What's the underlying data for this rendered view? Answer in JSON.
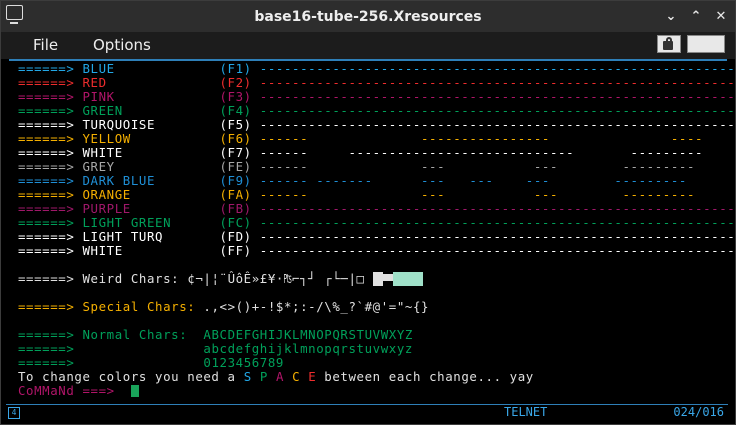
{
  "window": {
    "title": "base16-tube-256.Xresources",
    "buttons": [
      "⌄",
      "⌃",
      "✕"
    ]
  },
  "menu": {
    "file": "File",
    "options": "Options"
  },
  "colors": {
    "blue": "#22a7e6",
    "red": "#ee2d2d",
    "pink": "#b11569",
    "green": "#00a05a",
    "turquoise": "#ffffff",
    "yellow": "#f5b000",
    "white": "#ffffff",
    "grey": "#a8a8a8",
    "darkblue": "#1f8fd6",
    "orange": "#f5b000",
    "purple": "#a0186a",
    "lightgreen": "#00a05a",
    "lightturq": "#ffffff",
    "status": "#3aa7e8"
  },
  "terminal": {
    "color_rows": [
      {
        "arrow": "======>",
        "name": "BLUE",
        "key": "(F1)",
        "bar": "-----------------------------------------------------------",
        "color": "#22a7e6"
      },
      {
        "arrow": "======>",
        "name": "RED",
        "key": "(F2)",
        "bar": "-----------------------------------------------------------",
        "color": "#ee2d2d"
      },
      {
        "arrow": "======>",
        "name": "PINK",
        "key": "(F3)",
        "bar": "-----------------------------------------------------------",
        "color": "#b11569"
      },
      {
        "arrow": "======>",
        "name": "GREEN",
        "key": "(F4)",
        "bar": "-----------------------------------------------------------",
        "color": "#00a05a"
      },
      {
        "arrow": "======>",
        "name": "TURQUOISE",
        "key": "(F5)",
        "bar": "-----------------------------------------------------------",
        "color": "#ffffff"
      },
      {
        "arrow": "======>",
        "name": "YELLOW",
        "key": "(F6)",
        "bar": "------              ----------------               ----",
        "color": "#f5b000"
      },
      {
        "arrow": "======>",
        "name": "WHITE",
        "key": "(F7)",
        "bar": "------     ----------------------------       ---------",
        "color": "#ffffff"
      },
      {
        "arrow": "======>",
        "name": "GREY",
        "key": "(FE)",
        "bar": "------              ---           ---        ---------",
        "color": "#a8a8a8"
      },
      {
        "arrow": "======>",
        "name": "DARK BLUE",
        "key": "(F9)",
        "bar": "------ -------      ---   ---    ---        ---------",
        "color": "#1f8fd6"
      },
      {
        "arrow": "======>",
        "name": "ORANGE",
        "key": "(FA)",
        "bar": "------              ---           ---        ---------",
        "color": "#f5b000"
      },
      {
        "arrow": "======>",
        "name": "PURPLE",
        "key": "(FB)",
        "bar": "-----------------------------------------------------------",
        "color": "#a0186a"
      },
      {
        "arrow": "======>",
        "name": "LIGHT GREEN",
        "key": "(FC)",
        "bar": "-----------------------------------------------------------",
        "color": "#00a05a"
      },
      {
        "arrow": "======>",
        "name": "LIGHT TURQ",
        "key": "(FD)",
        "bar": "-----------------------------------------------------------",
        "color": "#ffffff"
      },
      {
        "arrow": "======>",
        "name": "WHITE",
        "key": "(FF)",
        "bar": "-----------------------------------------------------------",
        "color": "#ffffff"
      }
    ],
    "weird": {
      "arrow": "======>",
      "label": "Weird Chars:",
      "chars": "¢¬|¦¨ÛôÊ»£¥·₧⌐┐┘ ┌└─|□"
    },
    "special": {
      "arrow": "======>",
      "label": "Special Chars:",
      "chars": ".,<>()+-!$*;:-/\\%_?`#@'=\"~{}"
    },
    "normal": {
      "arrow": "======>",
      "label": "Normal Chars:",
      "arrow2": "======>",
      "arrow3": "======>",
      "upper": "ABCDEFGHIJKLMNOPQRSTUVWXYZ",
      "lower": "abcdefghijklmnopqrstuvwxyz",
      "digits": "0123456789"
    },
    "message": {
      "before": "To change colors you need a ",
      "s": "S",
      "p": "P",
      "a": "A",
      "c": "C",
      "e": "E",
      "after": " between each change... yay"
    },
    "prompt": {
      "label": "CoMMaNd ===>"
    }
  },
  "status": {
    "mode": "TELNET",
    "position": "024/016"
  }
}
